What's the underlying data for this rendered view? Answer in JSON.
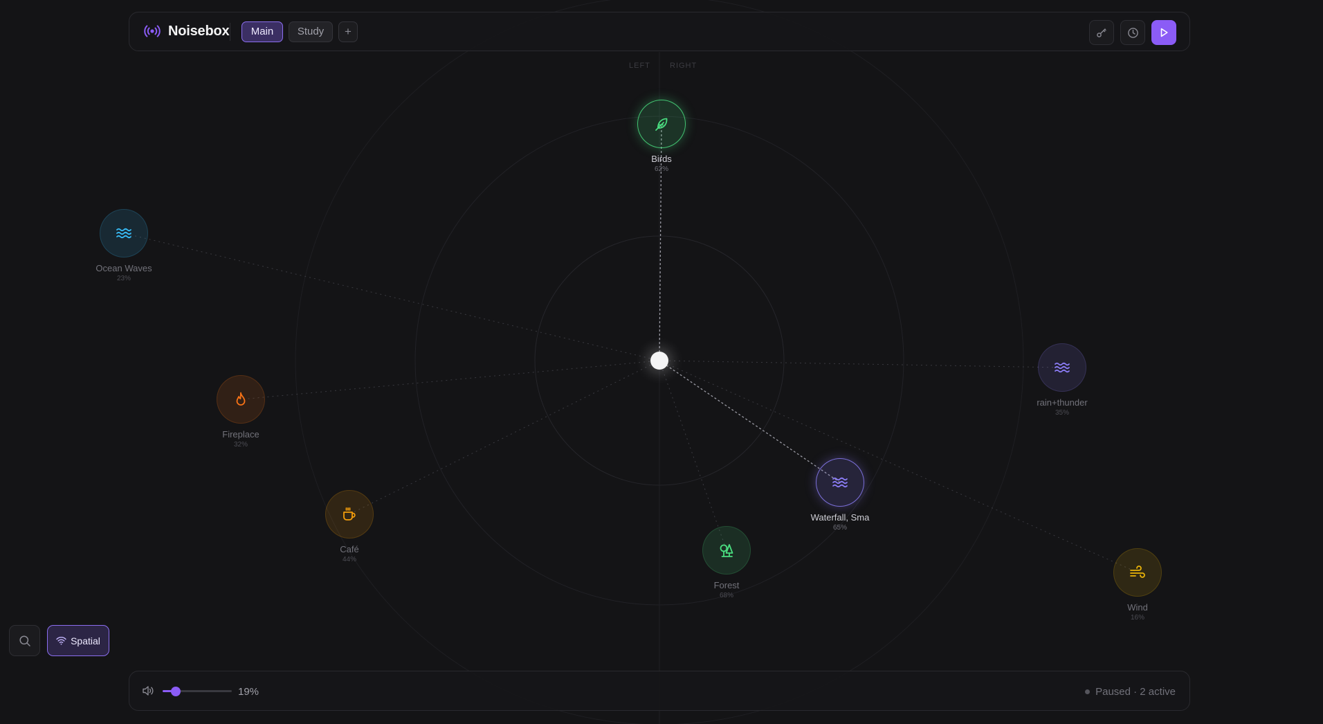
{
  "app": {
    "title": "Noisebox"
  },
  "tabs": [
    {
      "label": "Main",
      "active": true
    },
    {
      "label": "Study",
      "active": false
    },
    {
      "label": "+",
      "active": false
    }
  ],
  "toolbar": {
    "buttons": [
      {
        "icon": "key-icon"
      },
      {
        "icon": "clock-icon"
      },
      {
        "icon": "play-icon"
      }
    ]
  },
  "stereo": {
    "left_label": "LEFT",
    "right_label": "RIGHT"
  },
  "sounds": [
    {
      "name": "Birds",
      "volume": "62%",
      "icon": "feather-icon",
      "color": "#4ade80",
      "active": true
    },
    {
      "name": "Ocean Waves",
      "volume": "23%",
      "icon": "waves-icon",
      "color": "#38bdf8",
      "active": false
    },
    {
      "name": "Fireplace",
      "volume": "32%",
      "icon": "flame-icon",
      "color": "#f97316",
      "active": false
    },
    {
      "name": "Café",
      "volume": "44%",
      "icon": "coffee-icon",
      "color": "#f59e0b",
      "active": false
    },
    {
      "name": "Forest",
      "volume": "68%",
      "icon": "trees-icon",
      "color": "#4ade80",
      "active": false
    },
    {
      "name": "Waterfall, Sma",
      "volume": "65%",
      "icon": "waves-icon",
      "color": "#8b7cf6",
      "active": true
    },
    {
      "name": "rain+thunder",
      "volume": "35%",
      "icon": "waves-icon",
      "color": "#8b7cf6",
      "active": false
    },
    {
      "name": "Wind",
      "volume": "16%",
      "icon": "wind-icon",
      "color": "#eab308",
      "active": false
    }
  ],
  "controls": {
    "search_icon": "search-icon",
    "spatial_label": "Spatial",
    "spatial_icon": "wifi-icon"
  },
  "bottom": {
    "volume_label": "19%",
    "volume_value": 0.19,
    "status": "Paused · 2 active"
  },
  "colors": {
    "accent": "#8b5cf6",
    "background": "#141416"
  }
}
